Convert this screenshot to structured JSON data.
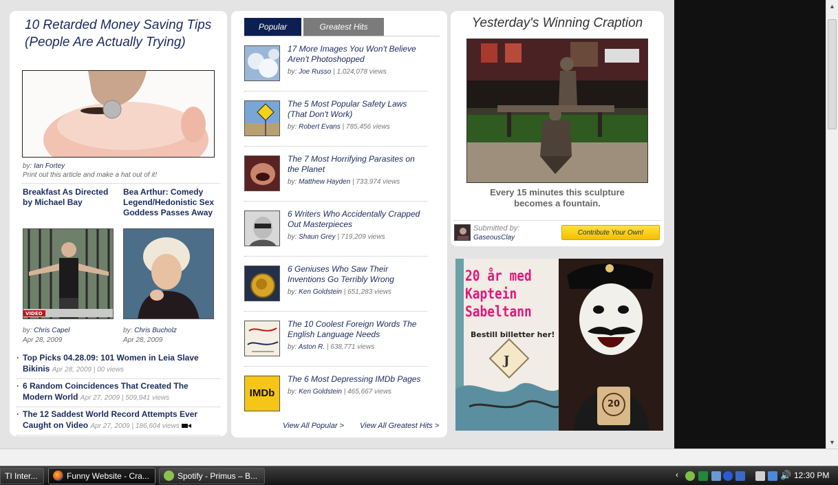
{
  "featured": {
    "title": "10 Retarded Money Saving Tips (People Are Actually Trying)",
    "by_label": "by:",
    "author": "Ian Fortey",
    "subtitle": "Print out this article and make a hat out of it!"
  },
  "mini_articles": [
    {
      "title": "Breakfast As Directed by Michael Bay",
      "by_label": "by:",
      "author": "Chris Capel",
      "date": "Apr 28, 2009",
      "badge": "VIDEO"
    },
    {
      "title": "Bea Arthur: Comedy Legend/Hedonistic Sex Goddess Passes Away",
      "by_label": "by:",
      "author": "Chris Bucholz",
      "date": "Apr 28, 2009"
    }
  ],
  "bullets": [
    {
      "title": "Top Picks 04.28.09: 101 Women in Leia Slave Bikinis",
      "meta": "Apr 28, 2009 | 00 views"
    },
    {
      "title": "6 Random Coincidences That Created The Modern World",
      "meta": "Apr 27, 2009 | 509,941 views"
    },
    {
      "title": "The 12 Saddest World Record Attempts Ever Caught on Video",
      "meta": "Apr 27, 2009 | 186,604 views"
    }
  ],
  "tabs": {
    "popular": "Popular",
    "greatest_hits": "Greatest Hits"
  },
  "popular": [
    {
      "title": "17 More Images You Won't Believe Aren't Photoshopped",
      "by_label": "by:",
      "author": "Joe Russo",
      "views": "| 1,024,078 views"
    },
    {
      "title": "The 5 Most Popular Safety Laws (That Don't Work)",
      "by_label": "by:",
      "author": "Robert Evans",
      "views": "| 785,456 views"
    },
    {
      "title": "The 7 Most Horrifying Parasites on the Planet",
      "by_label": "by:",
      "author": "Matthew Hayden",
      "views": "| 733,974 views"
    },
    {
      "title": "6 Writers Who Accidentally Crapped Out Masterpieces",
      "by_label": "by:",
      "author": "Shaun Grey",
      "views": "| 719,209 views"
    },
    {
      "title": "6 Geniuses Who Saw Their Inventions Go Terribly Wrong",
      "by_label": "by:",
      "author": "Ken Goldstein",
      "views": "| 651,283 views"
    },
    {
      "title": "The 10 Coolest Foreign Words The English Language Needs",
      "by_label": "by:",
      "author": "Aston R.",
      "views": "| 638,771 views"
    },
    {
      "title": "The 6 Most Depressing IMDb Pages",
      "by_label": "by:",
      "author": "Ken Goldstein",
      "views": "| 465,667 views"
    }
  ],
  "imdb_logo": "IMDb",
  "view_all_popular": "View All Popular >",
  "view_all_greatest": "View All Greatest Hits >",
  "craption": {
    "title": "Yesterday's Winning Craption",
    "caption": "Every 15 minutes this sculpture becomes a fountain.",
    "submitted_label": "Submitted by:",
    "submitter": "GaseousClay",
    "contribute_label": "Contribute Your Own!"
  },
  "ad": {
    "headline": "20 år med Kaptein Sabeltann",
    "cta": "Bestill billetter her!",
    "badge_number": "20"
  },
  "taskbar": {
    "items": [
      {
        "label": "TI Inter...",
        "active": false
      },
      {
        "label": "Funny Website - Cra...",
        "active": true
      },
      {
        "label": "Spotify - Primus – B...",
        "active": false
      }
    ],
    "clock": "12:30 PM"
  },
  "colors": {
    "link_navy": "#1a2a5c",
    "tab_active": "#0c1f52",
    "tab_inactive": "#7b7b7b",
    "button_yellow": "#f4bf00"
  }
}
